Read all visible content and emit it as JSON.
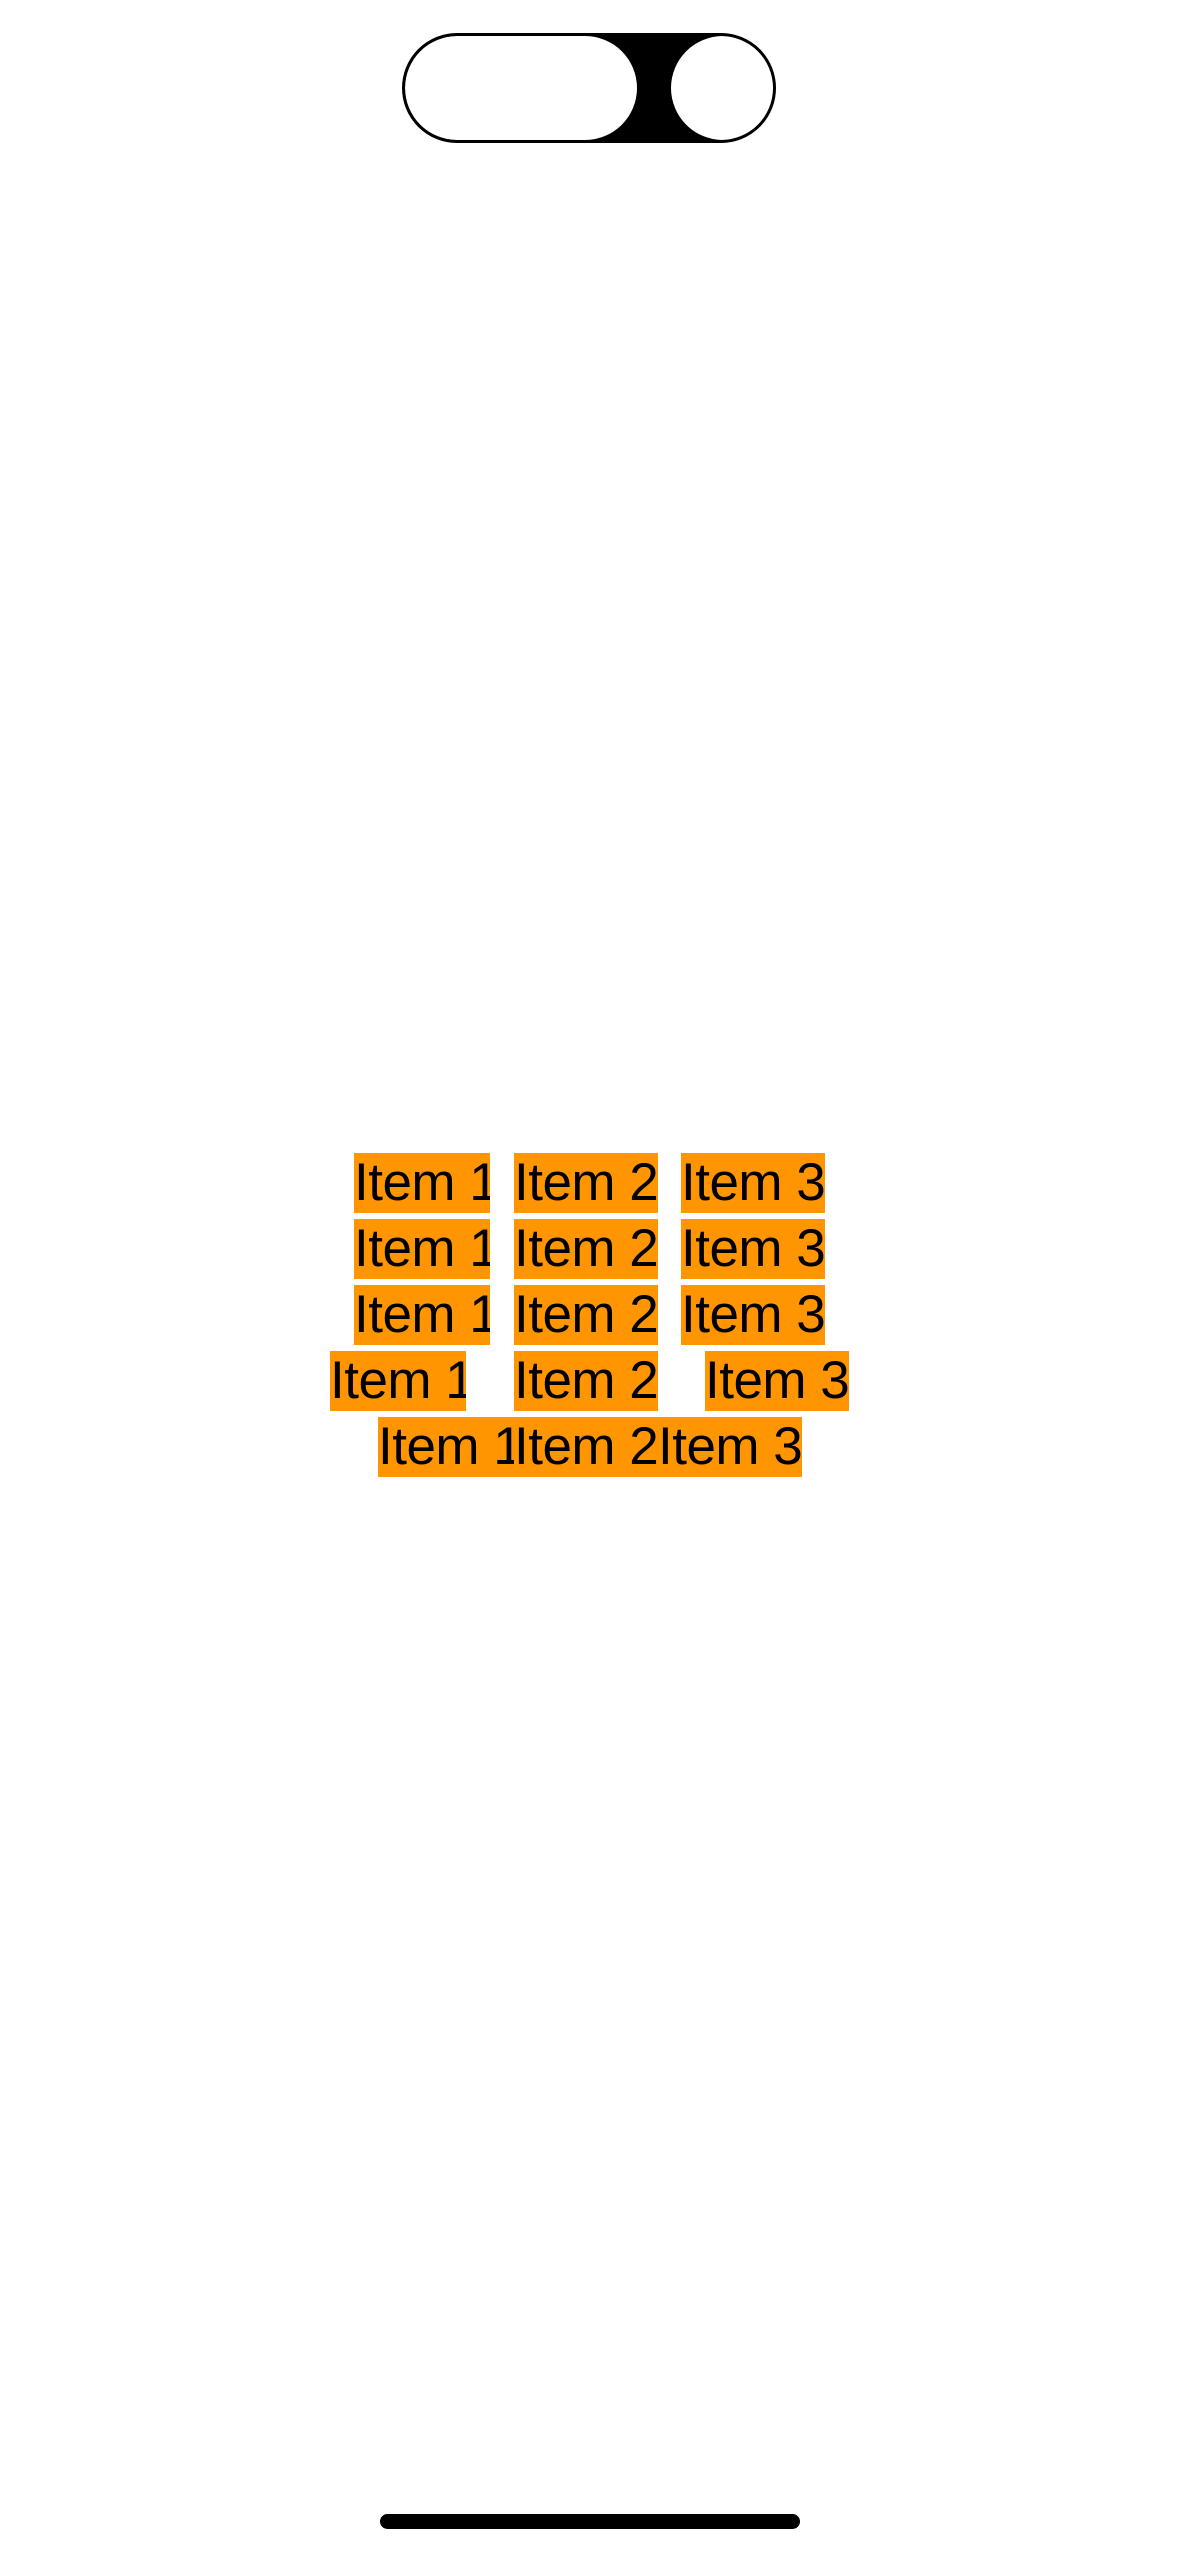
{
  "rows": [
    {
      "items": [
        "Item 1",
        "Item 2",
        "Item 3"
      ]
    },
    {
      "items": [
        "Item 1",
        "Item 2",
        "Item 3"
      ]
    },
    {
      "items": [
        "Item 1",
        "Item 2",
        "Item 3"
      ]
    },
    {
      "items": [
        "Item 1",
        "Item 2",
        "Item 3"
      ]
    },
    {
      "items": [
        "Item 1",
        "Item 2",
        "Item 3"
      ]
    }
  ],
  "colors": {
    "item_background": "#ff9500",
    "text": "#000000",
    "background": "#ffffff"
  }
}
